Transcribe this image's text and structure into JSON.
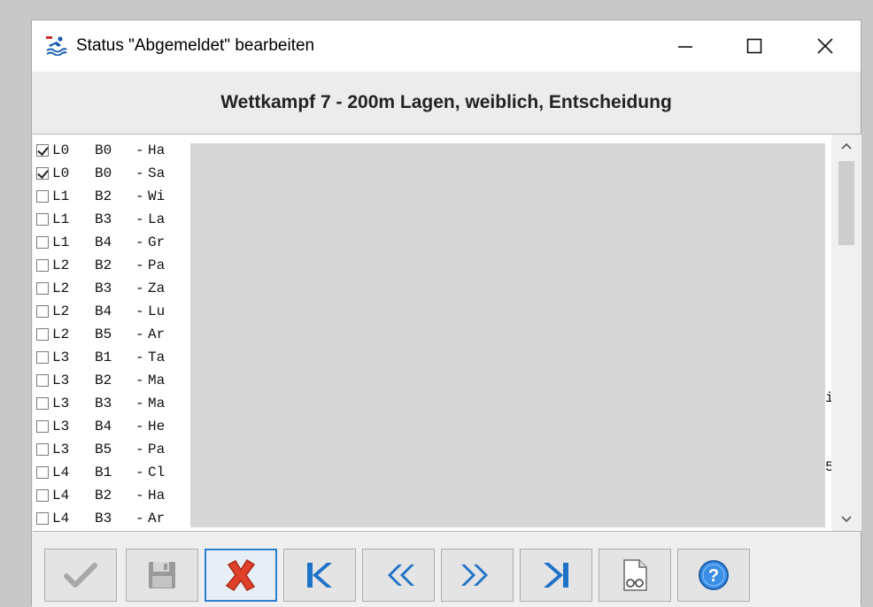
{
  "window": {
    "title": "Status \"Abgemeldet\" bearbeiten",
    "icon": "swimmer-icon"
  },
  "header": {
    "title": "Wettkampf 7 - 200m Lagen, weiblich, Entscheidung"
  },
  "list": {
    "rows": [
      {
        "checked": true,
        "lane": "L0",
        "heat": "B0",
        "dash": "-",
        "name": "Ha"
      },
      {
        "checked": true,
        "lane": "L0",
        "heat": "B0",
        "dash": "-",
        "name": "Sa"
      },
      {
        "checked": false,
        "lane": "L1",
        "heat": "B2",
        "dash": "-",
        "name": "Wi"
      },
      {
        "checked": false,
        "lane": "L1",
        "heat": "B3",
        "dash": "-",
        "name": "La"
      },
      {
        "checked": false,
        "lane": "L1",
        "heat": "B4",
        "dash": "-",
        "name": "Gr"
      },
      {
        "checked": false,
        "lane": "L2",
        "heat": "B2",
        "dash": "-",
        "name": "Pa"
      },
      {
        "checked": false,
        "lane": "L2",
        "heat": "B3",
        "dash": "-",
        "name": "Za"
      },
      {
        "checked": false,
        "lane": "L2",
        "heat": "B4",
        "dash": "-",
        "name": "Lu"
      },
      {
        "checked": false,
        "lane": "L2",
        "heat": "B5",
        "dash": "-",
        "name": "Ar"
      },
      {
        "checked": false,
        "lane": "L3",
        "heat": "B1",
        "dash": "-",
        "name": "Ta"
      },
      {
        "checked": false,
        "lane": "L3",
        "heat": "B2",
        "dash": "-",
        "name": "Ma"
      },
      {
        "checked": false,
        "lane": "L3",
        "heat": "B3",
        "dash": "-",
        "name": "Ma"
      },
      {
        "checked": false,
        "lane": "L3",
        "heat": "B4",
        "dash": "-",
        "name": "He"
      },
      {
        "checked": false,
        "lane": "L3",
        "heat": "B5",
        "dash": "-",
        "name": "Pa"
      },
      {
        "checked": false,
        "lane": "L4",
        "heat": "B1",
        "dash": "-",
        "name": "Cl"
      },
      {
        "checked": false,
        "lane": "L4",
        "heat": "B2",
        "dash": "-",
        "name": "Ha"
      },
      {
        "checked": false,
        "lane": "L4",
        "heat": "B3",
        "dash": "-",
        "name": "Ar"
      }
    ],
    "overflow": {
      "row12": "i",
      "row15": "5"
    }
  },
  "toolbar": {
    "buttons": [
      {
        "name": "confirm-button",
        "icon": "checkmark-icon",
        "enabled": false
      },
      {
        "name": "save-button",
        "icon": "floppy-disk-icon",
        "enabled": false
      },
      {
        "name": "cancel-button",
        "icon": "red-x-icon",
        "enabled": true
      },
      {
        "name": "first-button",
        "icon": "skip-to-start-icon",
        "enabled": true
      },
      {
        "name": "previous-button",
        "icon": "double-chevron-left-icon",
        "enabled": true
      },
      {
        "name": "next-button",
        "icon": "double-chevron-right-icon",
        "enabled": true
      },
      {
        "name": "last-button",
        "icon": "skip-to-end-icon",
        "enabled": true
      },
      {
        "name": "print-preview-button",
        "icon": "document-glasses-icon",
        "enabled": true
      },
      {
        "name": "help-button",
        "icon": "question-mark-icon",
        "enabled": true
      }
    ]
  },
  "colors": {
    "accent_blue": "#1e72c8",
    "red_x": "#e0402a",
    "disabled_gray": "#a8a8a8"
  }
}
